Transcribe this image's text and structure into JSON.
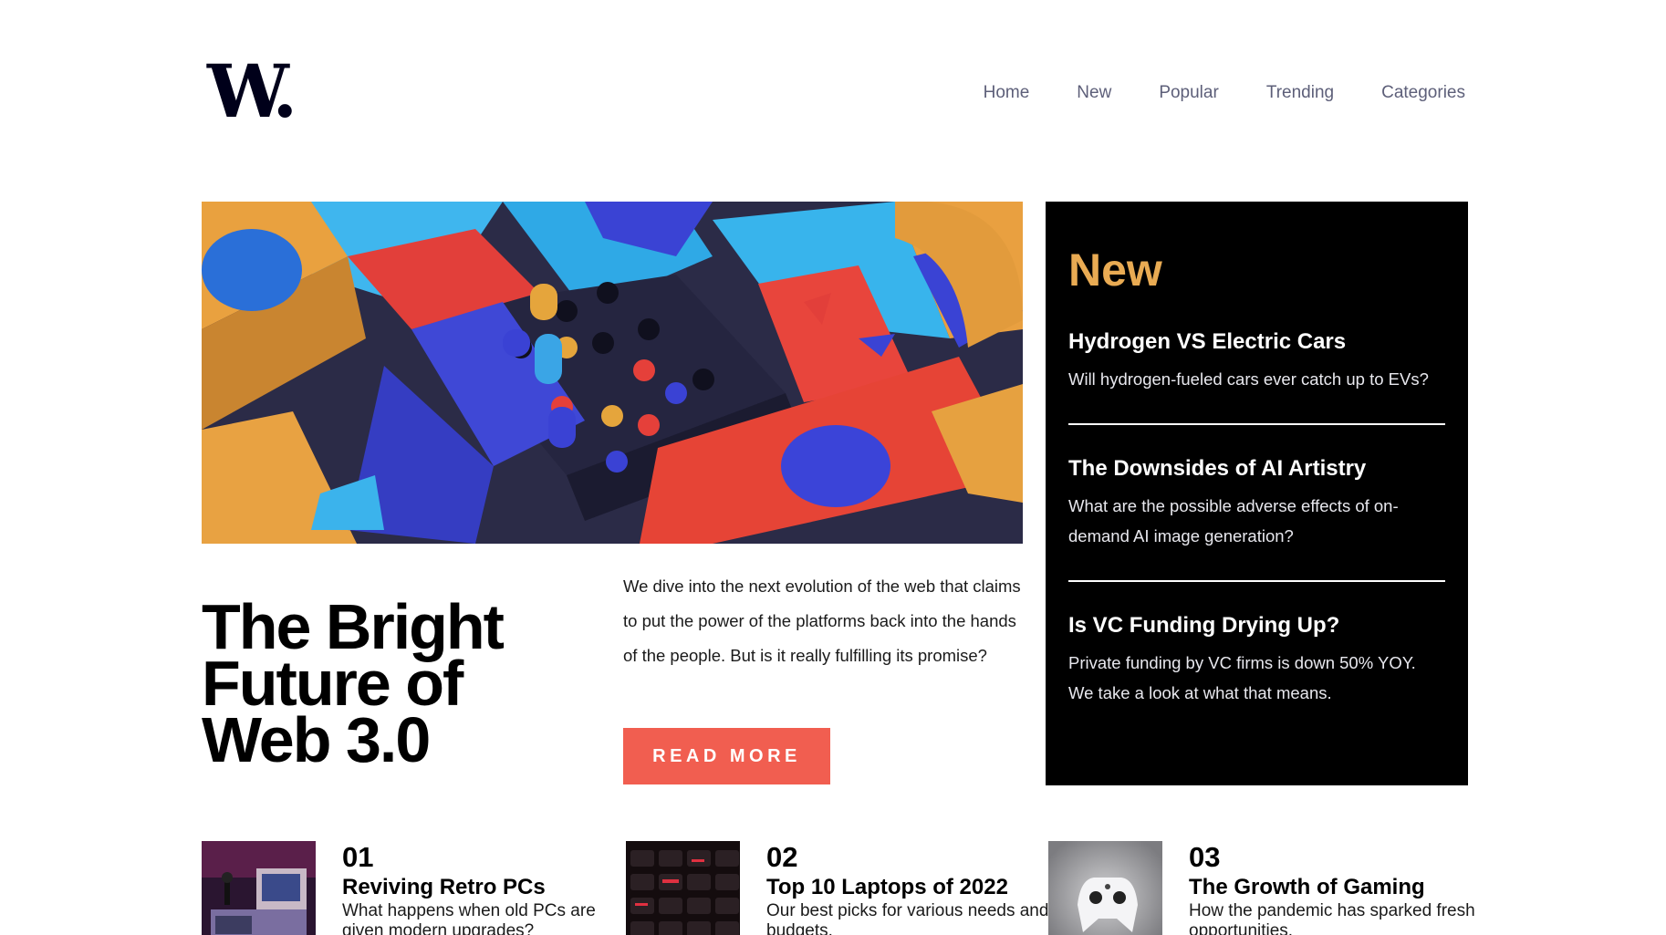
{
  "brand": {
    "logo_text": "W."
  },
  "nav": {
    "items": [
      "Home",
      "New",
      "Popular",
      "Trending",
      "Categories"
    ]
  },
  "hero": {
    "title": "The Bright Future of Web 3.0",
    "description": "We dive into the next evolution of the web that claims to put the power of the platforms back into the hands of the people. But is it really fulfilling its promise?",
    "button_label": "READ MORE"
  },
  "new_panel": {
    "heading": "New",
    "items": [
      {
        "title": "Hydrogen VS Electric Cars",
        "text": "Will hydrogen-fueled cars ever catch up to EVs?"
      },
      {
        "title": "The Downsides of AI Artistry",
        "text": "What are the possible adverse effects of on-demand AI image generation?"
      },
      {
        "title": "Is VC Funding Drying Up?",
        "text": "Private funding by VC firms is down 50% YOY. We take a look at what that means."
      }
    ]
  },
  "bottom_cards": [
    {
      "num": "01",
      "title": "Reviving Retro PCs",
      "text": "What happens when old PCs are given modern upgrades?"
    },
    {
      "num": "02",
      "title": "Top 10 Laptops of 2022",
      "text": "Our best picks for various needs and budgets."
    },
    {
      "num": "03",
      "title": "The Growth of Gaming",
      "text": "How the pandemic has sparked fresh opportunities."
    }
  ],
  "colors": {
    "accent": "#f15e50",
    "panel_heading": "#e9ab53",
    "nav_text": "#5d5f79",
    "panel_bg": "#000000"
  }
}
